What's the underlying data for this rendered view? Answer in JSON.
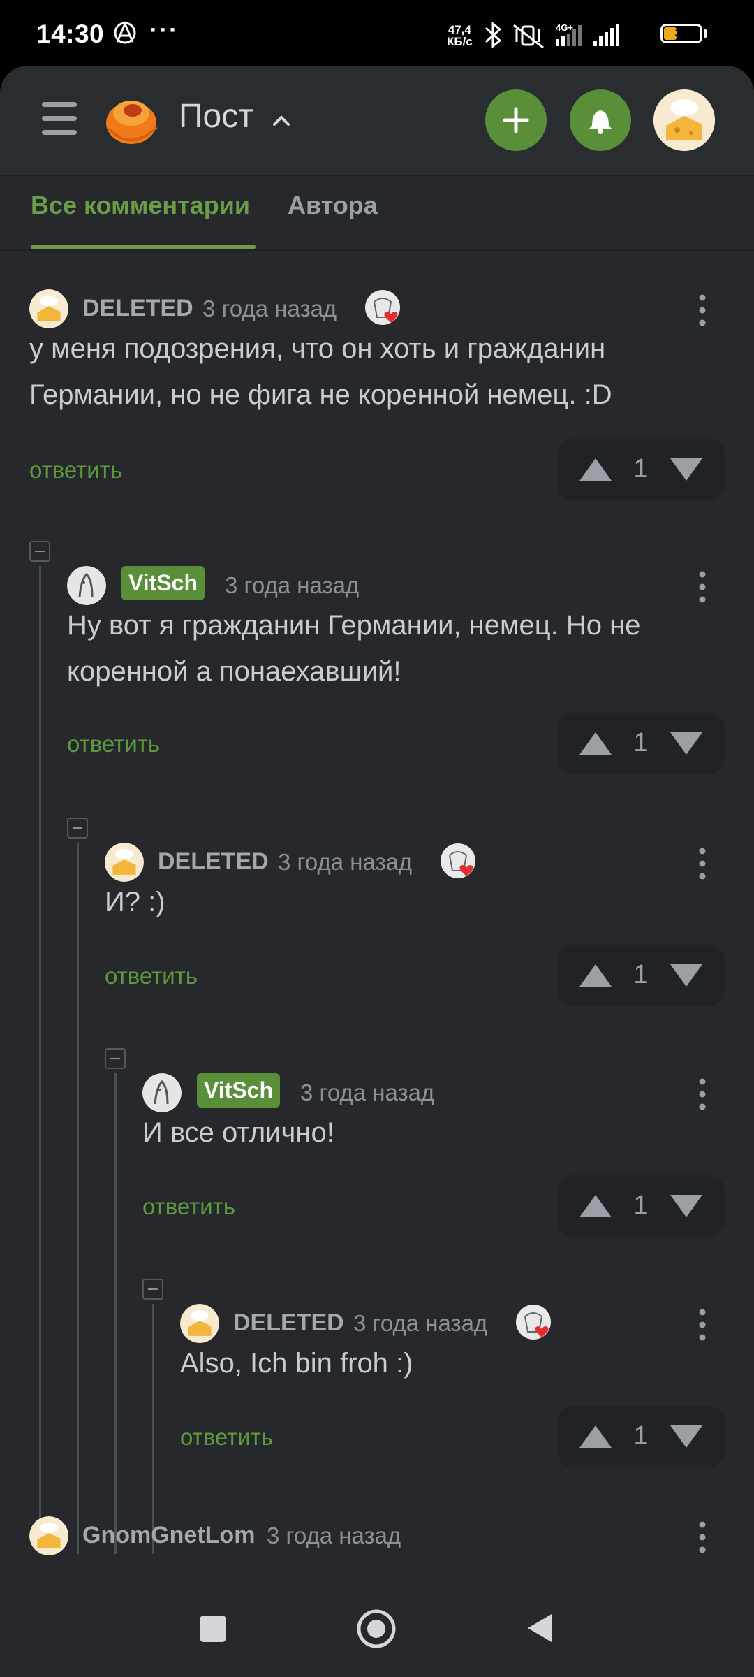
{
  "status_bar": {
    "time": "14:30",
    "speed_value": "47,4",
    "speed_unit": "КБ/с",
    "network": "4G+",
    "battery": "36",
    "battery_level": 0.36
  },
  "header": {
    "title": "Пост",
    "icons": [
      "menu-icon",
      "pikabu-logo",
      "chevron-up-icon",
      "plus-icon",
      "bell-icon",
      "user-avatar"
    ]
  },
  "tabs": {
    "all": "Все комментарии",
    "author": "Автора"
  },
  "comments": [
    {
      "author": "DELETED",
      "time": "3 года назад",
      "text": "у меня подозрения, что он хоть и гражданин Германии, но не фига не коренной немец.  :D",
      "reply": "ответить",
      "votes": "1"
    },
    {
      "author": "VitSch",
      "time": "3 года назад",
      "text": "Ну вот я гражданин Германии, немец. Но не коренной а понаехавший!",
      "reply": "ответить",
      "votes": "1"
    },
    {
      "author": "DELETED",
      "time": "3 года назад",
      "text": "И? :)",
      "reply": "ответить",
      "votes": "1"
    },
    {
      "author": "VitSch",
      "time": "3 года назад",
      "text": "И все отлично!",
      "reply": "ответить",
      "votes": "1"
    },
    {
      "author": "DELETED",
      "time": "3 года назад",
      "text": "Also, Ich bin froh :)",
      "reply": "ответить",
      "votes": "1"
    },
    {
      "author": "GnomGnetLom",
      "time": "3 года назад",
      "text": "",
      "reply": "",
      "votes": ""
    }
  ],
  "colors": {
    "accent_green": "#5a8f3a",
    "link_green": "#5d9a3e",
    "background": "#26282b"
  }
}
